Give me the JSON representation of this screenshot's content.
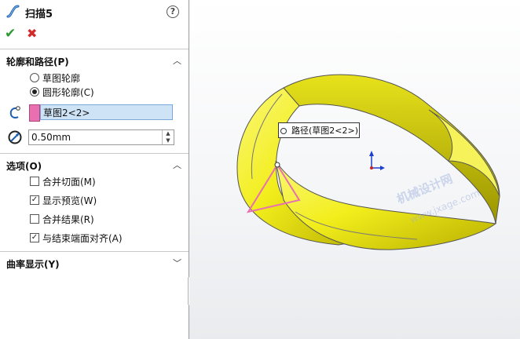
{
  "feature": {
    "title": "扫描5",
    "help_icon": "question-icon",
    "help_label": "?"
  },
  "actions": {
    "ok_icon": "check-icon",
    "ok_label": "✔",
    "cancel_icon": "close-icon",
    "cancel_label": "✖"
  },
  "profile_path": {
    "header": "轮廓和路径(P)",
    "options": [
      {
        "label": "草图轮廓",
        "selected": false
      },
      {
        "label": "圆形轮廓(C)",
        "selected": true
      }
    ],
    "path_value": "草图2<2>",
    "diameter_value": "0.50mm",
    "path_color": "#e86fb0"
  },
  "options_section": {
    "header": "选项(O)",
    "items": [
      {
        "label": "合并切面(M)",
        "checked": false
      },
      {
        "label": "显示预览(W)",
        "checked": true
      },
      {
        "label": "合并结果(R)",
        "checked": false
      },
      {
        "label": "与结束端面对齐(A)",
        "checked": true
      }
    ]
  },
  "curvature": {
    "header": "曲率显示(Y)"
  },
  "viewport": {
    "tooltip": "路径(草图2<2>)",
    "watermark_line1": "机械设计网",
    "watermark_line2": "www.jxage.com",
    "model_color": "#f2ee1c"
  }
}
